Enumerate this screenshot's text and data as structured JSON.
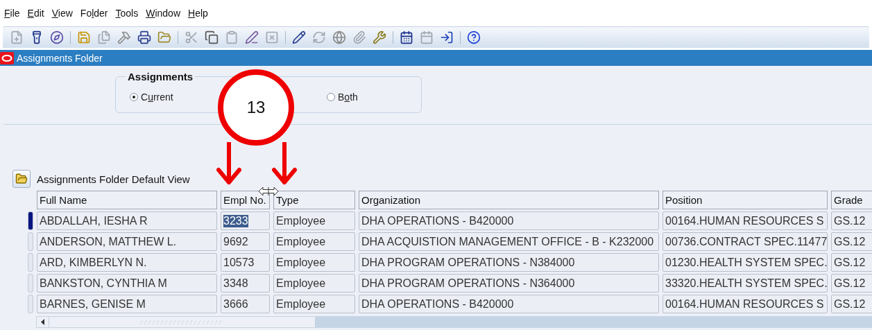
{
  "menu": [
    {
      "key": "F",
      "post": "ile"
    },
    {
      "key": "E",
      "post": "dit"
    },
    {
      "key": "V",
      "post": "iew"
    },
    {
      "pre": "Fo",
      "key": "l",
      "post": "der"
    },
    {
      "key": "T",
      "post": "ools"
    },
    {
      "key": "W",
      "post": "indow"
    },
    {
      "key": "H",
      "post": "elp"
    }
  ],
  "window": {
    "title": "Assignments Folder"
  },
  "assignments": {
    "legend": "Assignments",
    "options": [
      {
        "pre": "C",
        "key": "u",
        "post": "rrent",
        "selected": true
      },
      {
        "pre": "B",
        "key": "o",
        "post": "th",
        "selected": false
      }
    ]
  },
  "folder": {
    "title": "Assignments Folder Default View"
  },
  "table": {
    "columns": [
      "Full Name",
      "Empl No.",
      "Type",
      "Organization",
      "Position",
      "Grade"
    ],
    "rows": [
      {
        "selected": true,
        "cells": [
          "ABDALLAH, IESHA R",
          "3233",
          "Employee",
          "DHA OPERATIONS - B420000",
          "00164.HUMAN RESOURCES S",
          "GS.12"
        ]
      },
      {
        "selected": false,
        "cells": [
          "ANDERSON, MATTHEW L.",
          "9692",
          "Employee",
          "DHA ACQUISTION MANAGEMENT OFFICE - B - K232000",
          "00736.CONTRACT SPEC.11477",
          "GS.12"
        ]
      },
      {
        "selected": false,
        "cells": [
          "ARD, KIMBERLYN N.",
          "10573",
          "Employee",
          "DHA PROGRAM OPERATIONS - N384000",
          "01230.HEALTH SYSTEM SPEC.",
          "GS.12"
        ]
      },
      {
        "selected": false,
        "cells": [
          "BANKSTON, CYNTHIA M",
          "3348",
          "Employee",
          "DHA PROGRAM OPERATIONS - N364000",
          "33320.HEALTH SYSTEM SPEC.",
          "GS.12"
        ]
      },
      {
        "selected": false,
        "cells": [
          "BARNES, GENISE M",
          "3666",
          "Employee",
          "DHA OPERATIONS - B420000",
          "00164.HUMAN RESOURCES S",
          "GS.12"
        ]
      }
    ]
  },
  "annotation": {
    "label": "13"
  }
}
